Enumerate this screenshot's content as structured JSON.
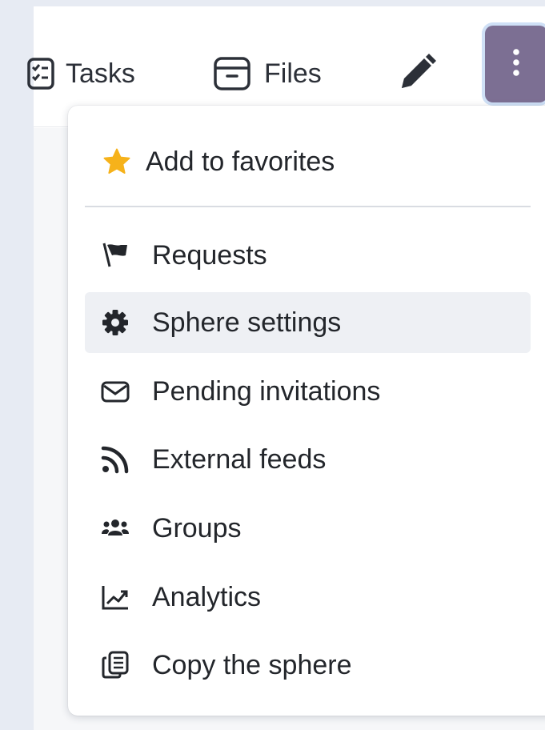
{
  "toolbar": {
    "tasks_label": "Tasks",
    "files_label": "Files",
    "more_button_color": "#7c6f93"
  },
  "menu": {
    "favorite": {
      "label": "Add to favorites",
      "icon": "star-icon",
      "icon_color": "#f6b21a"
    },
    "items": [
      {
        "label": "Requests",
        "icon": "flag-icon"
      },
      {
        "label": "Sphere settings",
        "icon": "gear-icon",
        "highlighted": true
      },
      {
        "label": "Pending invitations",
        "icon": "envelope-icon"
      },
      {
        "label": "External feeds",
        "icon": "rss-icon"
      },
      {
        "label": "Groups",
        "icon": "users-icon"
      },
      {
        "label": "Analytics",
        "icon": "chart-line-icon"
      },
      {
        "label": "Copy the sphere",
        "icon": "copy-icon"
      }
    ]
  }
}
